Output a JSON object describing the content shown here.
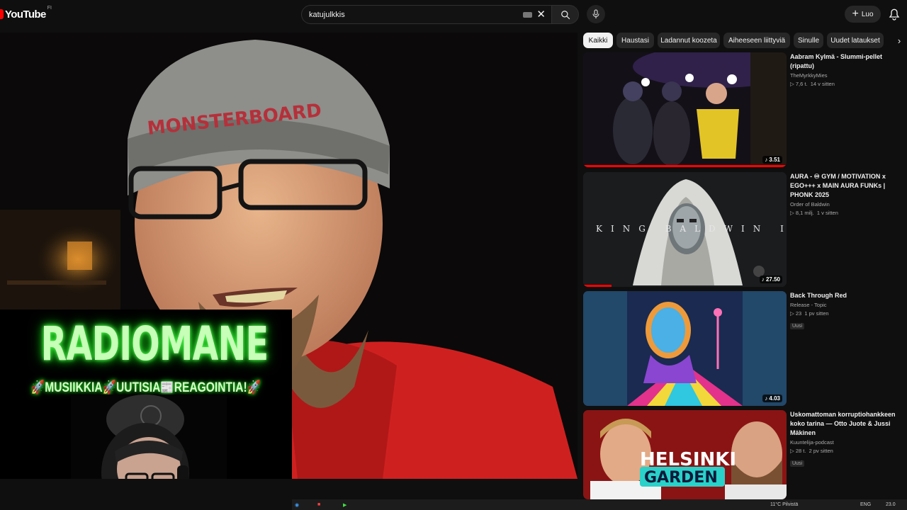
{
  "header": {
    "logo_text": "YouTube",
    "country_code": "FI",
    "search": {
      "value": "katujulkkis",
      "placeholder": ""
    },
    "create_label": "Luo"
  },
  "player": {
    "beanie_text": "MONSTERBOARD",
    "overlay_title": "RADIOMANE",
    "overlay_tagline": "🚀MUSIIKKIA🚀UUTISIA📰REAGOINTIA!🚀"
  },
  "chips": [
    {
      "label": "Kaikki",
      "active": true
    },
    {
      "label": "Haustasi",
      "active": false
    },
    {
      "label": "Ladannut koozeta",
      "active": false
    },
    {
      "label": "Aiheeseen liittyviä",
      "active": false
    },
    {
      "label": "Sinulle",
      "active": false
    },
    {
      "label": "Uudet lataukset",
      "active": false
    }
  ],
  "recommendations": [
    {
      "title": "Aabram Kylmä - Slummi-pellet (ripattu)",
      "channel": "TheMyrkkyMies",
      "views": "7,6 t.",
      "age": "14 v sitten",
      "duration": "3.51",
      "badge": "",
      "progress": 1.0
    },
    {
      "title": "AURA - ♾ GYM / MOTIVATION x EGO+++ x MAIN AURA FUNKs | PHONK 2025",
      "channel": "Order of Baldwin",
      "views": "8,1 milj.",
      "age": "1 v sitten",
      "duration": "27.50",
      "badge": "",
      "progress": 0.14,
      "thumb_text": "KING BALDWIN IV"
    },
    {
      "title": "Back Through Red",
      "channel": "Release - Topic",
      "views": "23",
      "age": "1 pv sitten",
      "duration": "4.03",
      "badge": "Uusi",
      "progress": 0
    },
    {
      "title": "Uskomattoman korruptiohankkeen koko tarina — Otto Juote & Jussi Mäkinen",
      "channel": "Kuuntelija-podcast",
      "views": "28 t.",
      "age": "2 pv sitten",
      "duration": "",
      "badge": "Uusi",
      "progress": 0,
      "thumb_text_1": "HELSINKI",
      "thumb_text_2": "GARDEN"
    }
  ],
  "taskbar": {
    "weather": "11°C  Pilvistä",
    "lang": "ENG",
    "time": "23.0"
  },
  "colors": {
    "accent": "#ff0000",
    "bg": "#0f0f0f",
    "chip": "#272727",
    "neon": "#1fd11f"
  }
}
